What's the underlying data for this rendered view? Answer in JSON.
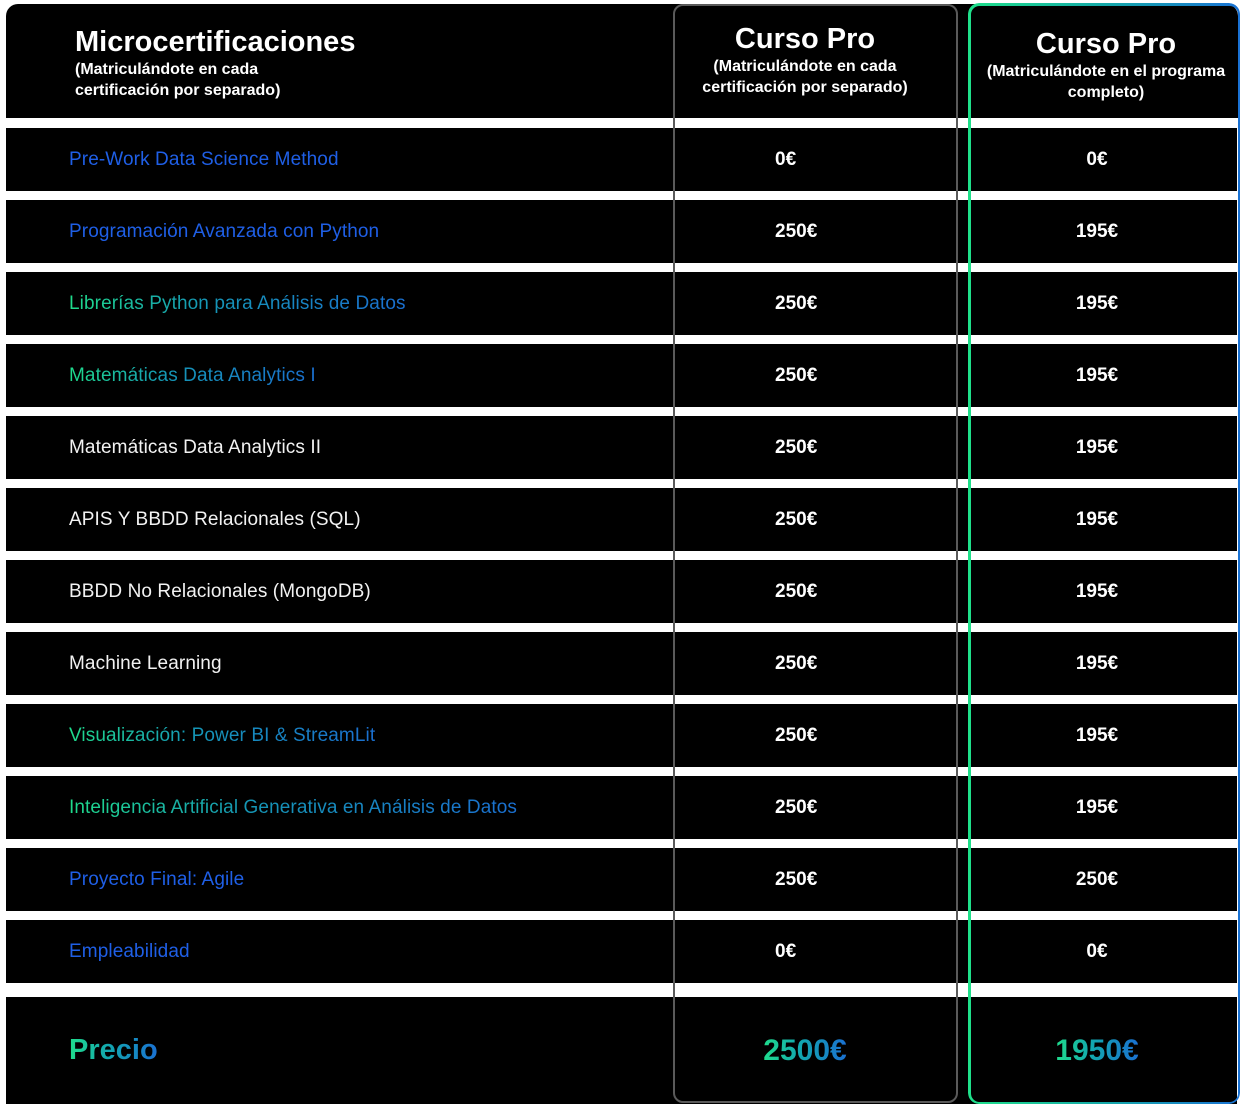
{
  "header": {
    "col1_title": "Microcertificaciones",
    "col1_subtitle": "(Matriculándote en cada certificación por separado)",
    "col2_title": "Curso Pro",
    "col2_subtitle": "(Matriculándote en cada certificación por separado)",
    "col3_title": "Curso Pro",
    "col3_subtitle": "(Matriculándote en el programa completo)"
  },
  "rows": [
    {
      "label": "Pre-Work Data Science Method",
      "style": "blue",
      "price_separate": "0€",
      "price_full": "0€"
    },
    {
      "label": "Programación Avanzada con Python",
      "style": "blue",
      "price_separate": "250€",
      "price_full": "195€"
    },
    {
      "label": "Librerías Python para Análisis de Datos",
      "style": "gradient",
      "price_separate": "250€",
      "price_full": "195€"
    },
    {
      "label": "Matemáticas Data Analytics I",
      "style": "gradient",
      "price_separate": "250€",
      "price_full": "195€"
    },
    {
      "label": "Matemáticas Data Analytics II",
      "style": "white",
      "price_separate": "250€",
      "price_full": "195€"
    },
    {
      "label": "APIS Y BBDD Relacionales (SQL)",
      "style": "white",
      "price_separate": "250€",
      "price_full": "195€"
    },
    {
      "label": "BBDD No Relacionales (MongoDB)",
      "style": "white",
      "price_separate": "250€",
      "price_full": "195€"
    },
    {
      "label": "Machine Learning",
      "style": "white",
      "price_separate": "250€",
      "price_full": "195€"
    },
    {
      "label": "Visualización: Power BI & StreamLit",
      "style": "gradient",
      "price_separate": "250€",
      "price_full": "195€"
    },
    {
      "label": "Inteligencia Artificial Generativa en Análisis de Datos",
      "style": "gradient",
      "price_separate": "250€",
      "price_full": "195€"
    },
    {
      "label": "Proyecto Final: Agile",
      "style": "blue",
      "price_separate": "250€",
      "price_full": "250€"
    },
    {
      "label": "Empleabilidad",
      "style": "blue",
      "price_separate": "0€",
      "price_full": "0€"
    }
  ],
  "total": {
    "label": "Precio",
    "price_separate": "2500€",
    "price_full": "1950€"
  },
  "colors": {
    "background": "#000000",
    "gap": "#ffffff",
    "blue_text": "#1f5fe6",
    "gradient_start": "#1fdc8c",
    "gradient_end": "#1a70d2",
    "gray_frame": "#5a5a5a"
  }
}
